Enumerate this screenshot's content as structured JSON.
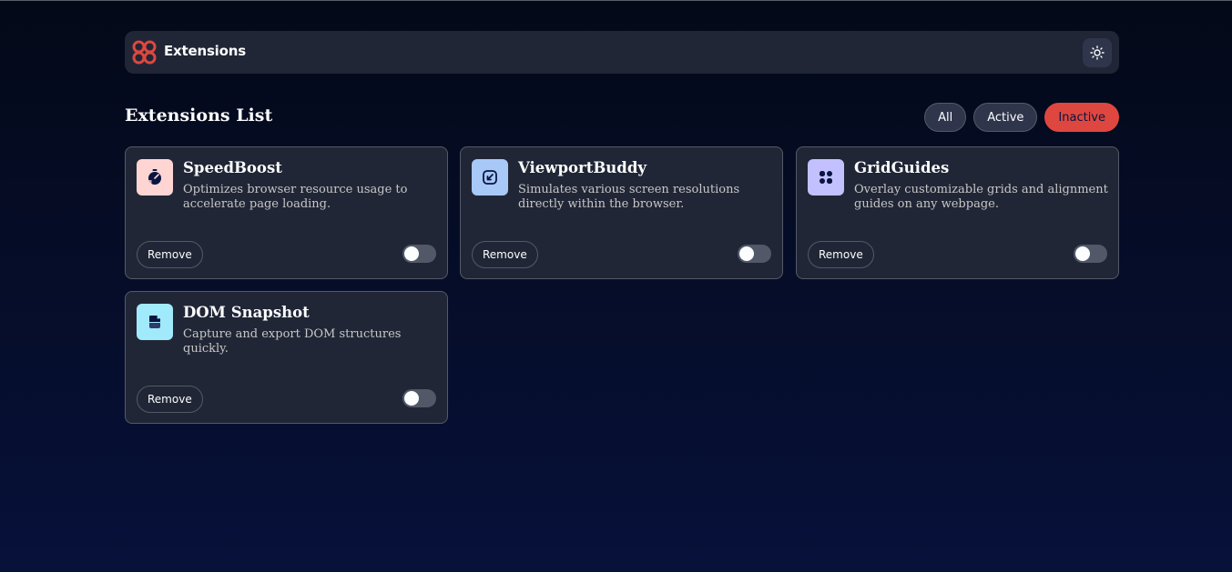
{
  "header": {
    "brand": "Extensions",
    "logo_icon": "extensions-logo-icon",
    "theme_icon": "sun-icon"
  },
  "main": {
    "title": "Extensions List",
    "filters": [
      {
        "label": "All",
        "selected": false
      },
      {
        "label": "Active",
        "selected": false
      },
      {
        "label": "Inactive",
        "selected": true
      }
    ]
  },
  "extensions": [
    {
      "name": "SpeedBoost",
      "description": "Optimizes browser resource usage to accelerate page loading.",
      "icon": "speedboost-icon",
      "icon_bg": "#ffd5d3",
      "remove_label": "Remove",
      "active": false
    },
    {
      "name": "ViewportBuddy",
      "description": "Simulates various screen resolutions directly within the browser.",
      "icon": "viewportbuddy-icon",
      "icon_bg": "#a8c8f8",
      "remove_label": "Remove",
      "active": false
    },
    {
      "name": "GridGuides",
      "description": "Overlay customizable grids and alignment guides on any webpage.",
      "icon": "gridguides-icon",
      "icon_bg": "#c3c0ff",
      "remove_label": "Remove",
      "active": false
    },
    {
      "name": "DOM Snapshot",
      "description": "Capture and export DOM structures quickly.",
      "icon": "domsnapshot-icon",
      "icon_bg": "#a1eafb",
      "remove_label": "Remove",
      "active": false
    }
  ],
  "colors": {
    "accent": "#de473f",
    "card_bg": "#212636",
    "border": "#545969"
  }
}
